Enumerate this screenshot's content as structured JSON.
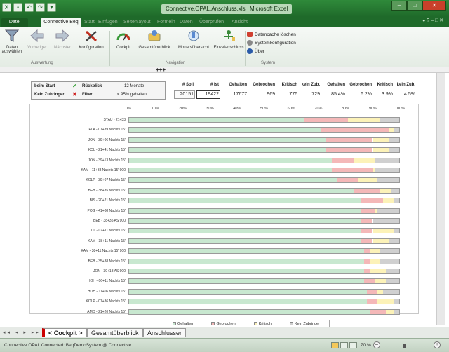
{
  "window": {
    "doc_title": "Connective.OPAL.Anschluss.xlsx",
    "app_title": "Microsoft Excel",
    "qat_icons": [
      "excel-icon",
      "save-icon",
      "undo-icon",
      "redo-icon",
      "customize-icon"
    ]
  },
  "ribbon_tabs": [
    {
      "label": "Datei"
    },
    {
      "label": "Connective Beq"
    },
    {
      "label": "Start"
    },
    {
      "label": "Einfügen"
    },
    {
      "label": "Seitenlayout"
    },
    {
      "label": "Formeln"
    },
    {
      "label": "Daten"
    },
    {
      "label": "Überprüfen"
    },
    {
      "label": "Ansicht"
    }
  ],
  "ribbon": {
    "groups": [
      {
        "label": "Auswertung"
      },
      {
        "label": "Navigation"
      },
      {
        "label": "System"
      }
    ],
    "buttons": [
      {
        "label": "Daten auswählen",
        "icon": "filter-icon"
      },
      {
        "label": "Vorheriger",
        "icon": "arrow-left-icon"
      },
      {
        "label": "Nächster",
        "icon": "arrow-right-icon"
      },
      {
        "label": "Konfiguration",
        "icon": "tools-icon"
      },
      {
        "label": "Cockpit",
        "icon": "gauge-icon"
      },
      {
        "label": "Gesamtüberblick",
        "icon": "overview-icon"
      },
      {
        "label": "Monatsübersicht",
        "icon": "monthly-icon"
      },
      {
        "label": "Einzelanschluss",
        "icon": "connection-icon"
      }
    ],
    "system": [
      {
        "label": "Datencache löschen",
        "icon": "clear-cache-icon"
      },
      {
        "label": "Systemkonfiguration",
        "icon": "settings-icon"
      },
      {
        "label": "Über",
        "icon": "info-icon"
      }
    ]
  },
  "plus_marker": "+++",
  "info": {
    "start_label": "beim Start",
    "rueckblick_label": "Rückblick",
    "rueckblick_value": "12 Monate",
    "kein_zubringer_label": "Kein Zubringer",
    "filter_label": "Filter",
    "filter_value": "< 95% gehalten"
  },
  "kpis": {
    "soll_label": "# Soll",
    "soll_value": "20151",
    "ist_label": "# Ist",
    "ist_value": "19422",
    "gehalten_label": "Gehalten",
    "gehalten_value": "17677",
    "gebrochen_label": "Gebrochen",
    "gebrochen_value": "969",
    "kritisch_label": "Kritisch",
    "kritisch_value": "776",
    "keinzub_label": "kein Zub.",
    "keinzub_value": "729",
    "gehalten_pct_label": "Gehalten",
    "gehalten_pct": "85.4%",
    "gebrochen_pct_label": "Gebrochen",
    "gebrochen_pct": "6.2%",
    "kritisch_pct_label": "Kritisch",
    "kritisch_pct": "3.9%",
    "keinzub_pct_label": "kein Zub.",
    "keinzub_pct": "4.5%"
  },
  "chart_data": {
    "type": "bar",
    "orientation": "horizontal",
    "stacked": true,
    "x_ticks": [
      "0%",
      "10%",
      "20%",
      "30%",
      "40%",
      "50%",
      "60%",
      "70%",
      "80%",
      "90%",
      "100%"
    ],
    "xlim": [
      0,
      100
    ],
    "categories": [
      "STAU - 21+33",
      "PLA - 07+39 Nachts 15'",
      "JON - 39+06 Nachts 15'",
      "KOL - 21+41 Nachts 15'",
      "JON - 39+13 Nachts 15'",
      "KAM - 11+38 Nachts 15' 900",
      "KOLP - 39+07 Nachts 15'",
      "BEB - 38+35 Nachts 15'",
      "BIS - 20+21 Nachts 15'",
      "POG - 41+08 Nachts 15'",
      "BEB - 38+35 AS 900",
      "TIL - 07+11 Nachts 15'",
      "KAM - 38+11 Nachts 15'",
      "KAM - 38+11 Nachts 15' 900",
      "BEB - 35+38 Nachts 15'",
      "JON - 39+13 AS 900",
      "HOH - 06+11 Nachts 15'",
      "HOH - 11+06 Nachts 15'",
      "KOLP - 07+36 Nachts 15'",
      "AMO - 21+20 Nachts 15'"
    ],
    "series": [
      {
        "name": "Gehalten",
        "color": "#c8e8d0",
        "values": [
          65,
          71,
          73,
          73,
          75,
          75,
          77,
          83,
          86,
          86,
          86,
          86,
          86,
          87,
          87,
          87,
          87,
          88,
          88,
          89
        ]
      },
      {
        "name": "Gebrochen",
        "color": "#f4b8b8",
        "values": [
          16,
          25,
          17,
          17,
          8,
          15,
          8,
          10,
          8,
          5,
          4,
          4,
          4,
          2,
          2,
          2,
          4,
          4,
          4,
          6
        ]
      },
      {
        "name": "Kritisch",
        "color": "#fcf2b8",
        "values": [
          12,
          2,
          6,
          6,
          8,
          1,
          7,
          4,
          4,
          1,
          0,
          8,
          6,
          4,
          4,
          6,
          4,
          2,
          6,
          3
        ]
      },
      {
        "name": "Kein Zubringer",
        "color": "#d0d0d0",
        "values": [
          7,
          2,
          4,
          4,
          9,
          9,
          8,
          3,
          2,
          8,
          10,
          2,
          4,
          7,
          7,
          5,
          5,
          6,
          2,
          2
        ]
      }
    ],
    "legend_position": "bottom"
  },
  "sheet_tabs": [
    {
      "label": "< Cockpit >"
    },
    {
      "label": "Gesamtüberblick"
    },
    {
      "label": "Anschlusser"
    }
  ],
  "status": {
    "text": "Connective OPAL Connected: BeqDemoSystem @ Connective",
    "zoom": "70 %"
  }
}
